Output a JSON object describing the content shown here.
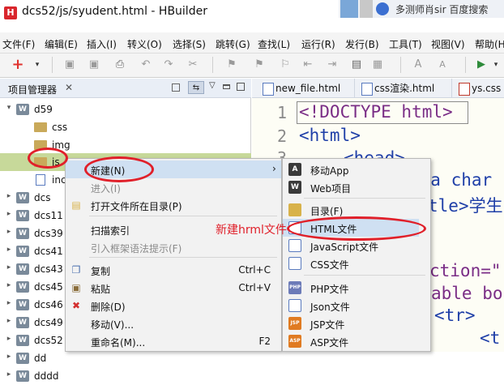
{
  "window": {
    "title": "dcs52/js/syudent.html  -  HBuilder",
    "app_icon_letter": "H",
    "taskbar_text": "多测师肖sir  百度搜索"
  },
  "menubar": [
    "文件(F)",
    "编辑(E)",
    "插入(I)",
    "转义(O)",
    "选择(S)",
    "跳转(G)",
    "查找(L)",
    "运行(R)",
    "发行(B)",
    "工具(T)",
    "视图(V)",
    "帮助(H)"
  ],
  "project_panel": {
    "title": "项目管理器",
    "close_glyph": "✕",
    "tree": [
      {
        "label": "d59",
        "arrow": "▾",
        "type": "project",
        "depth": 0
      },
      {
        "label": "css",
        "arrow": "",
        "type": "folder",
        "depth": 1
      },
      {
        "label": "img",
        "arrow": "",
        "type": "folder",
        "depth": 1
      },
      {
        "label": "js",
        "arrow": "",
        "type": "folder",
        "depth": 1
      },
      {
        "label": "inc",
        "arrow": "",
        "type": "file",
        "depth": 1
      },
      {
        "label": "dcs",
        "arrow": "▸",
        "type": "project",
        "depth": 0
      },
      {
        "label": "dcs11",
        "arrow": "▸",
        "type": "project",
        "depth": 0
      },
      {
        "label": "dcs39",
        "arrow": "▸",
        "type": "project",
        "depth": 0
      },
      {
        "label": "dcs41",
        "arrow": "▸",
        "type": "project",
        "depth": 0
      },
      {
        "label": "dcs43",
        "arrow": "▸",
        "type": "project",
        "depth": 0
      },
      {
        "label": "dcs45",
        "arrow": "▸",
        "type": "project",
        "depth": 0
      },
      {
        "label": "dcs46",
        "arrow": "▸",
        "type": "project",
        "depth": 0
      },
      {
        "label": "dcs49",
        "arrow": "▸",
        "type": "project",
        "depth": 0
      },
      {
        "label": "dcs52",
        "arrow": "▸",
        "type": "project",
        "depth": 0
      },
      {
        "label": "dd",
        "arrow": "▸",
        "type": "project",
        "depth": 0
      },
      {
        "label": "dddd",
        "arrow": "▸",
        "type": "project",
        "depth": 0
      }
    ]
  },
  "editor": {
    "tabs": [
      "new_file.html",
      "css渲染.html",
      "ys.css"
    ],
    "line_numbers": [
      "1",
      "2",
      "3"
    ],
    "lines": [
      "<!DOCTYPE html>",
      "<html>",
      "<head>",
      "eta char",
      "tle>学生",
      "ction=\"",
      "able bord",
      "<tr>",
      "<t"
    ]
  },
  "context_menu": {
    "items": [
      {
        "label": "新建(N)",
        "shortcut": "",
        "arrow": "›",
        "disabled": false,
        "icon": ""
      },
      {
        "label": "进入(I)",
        "shortcut": "",
        "arrow": "",
        "disabled": true,
        "icon": ""
      },
      {
        "label": "打开文件所在目录(P)",
        "shortcut": "",
        "arrow": "",
        "disabled": false,
        "icon": "folder"
      },
      {
        "label": "扫描索引",
        "shortcut": "",
        "arrow": "",
        "disabled": false,
        "icon": ""
      },
      {
        "label": "引入框架语法提示(F)",
        "shortcut": "",
        "arrow": "",
        "disabled": true,
        "icon": ""
      },
      {
        "label": "复制",
        "shortcut": "Ctrl+C",
        "arrow": "",
        "disabled": false,
        "icon": "copy"
      },
      {
        "label": "粘贴",
        "shortcut": "Ctrl+V",
        "arrow": "",
        "disabled": false,
        "icon": "paste"
      },
      {
        "label": "删除(D)",
        "shortcut": "",
        "arrow": "",
        "disabled": false,
        "icon": "delete"
      },
      {
        "label": "移动(V)...",
        "shortcut": "",
        "arrow": "",
        "disabled": false,
        "icon": ""
      },
      {
        "label": "重命名(M)...",
        "shortcut": "F2",
        "arrow": "",
        "disabled": false,
        "icon": ""
      }
    ]
  },
  "submenu": {
    "items": [
      {
        "label": "移动App",
        "icon_text": "A",
        "icon_color": "#3a3a3a"
      },
      {
        "label": "Web项目",
        "icon_text": "W",
        "icon_color": "#3a3a3a"
      },
      {
        "label": "目录(F)",
        "icon_text": "",
        "icon_color": "#d8b24a"
      },
      {
        "label": "HTML文件",
        "icon_text": "",
        "icon_color": "#ffffff"
      },
      {
        "label": "JavaScript文件",
        "icon_text": "",
        "icon_color": "#ffffff"
      },
      {
        "label": "CSS文件",
        "icon_text": "",
        "icon_color": "#ffffff"
      },
      {
        "label": "PHP文件",
        "icon_text": "PHP",
        "icon_color": "#6c7bb8"
      },
      {
        "label": "Json文件",
        "icon_text": "",
        "icon_color": "#ffffff"
      },
      {
        "label": "JSP文件",
        "icon_text": "JSP",
        "icon_color": "#e07b22"
      },
      {
        "label": "ASP文件",
        "icon_text": "ASP",
        "icon_color": "#e07b22"
      }
    ]
  },
  "annotation": {
    "text": "新建hrml文件",
    "color": "#e0202a"
  }
}
